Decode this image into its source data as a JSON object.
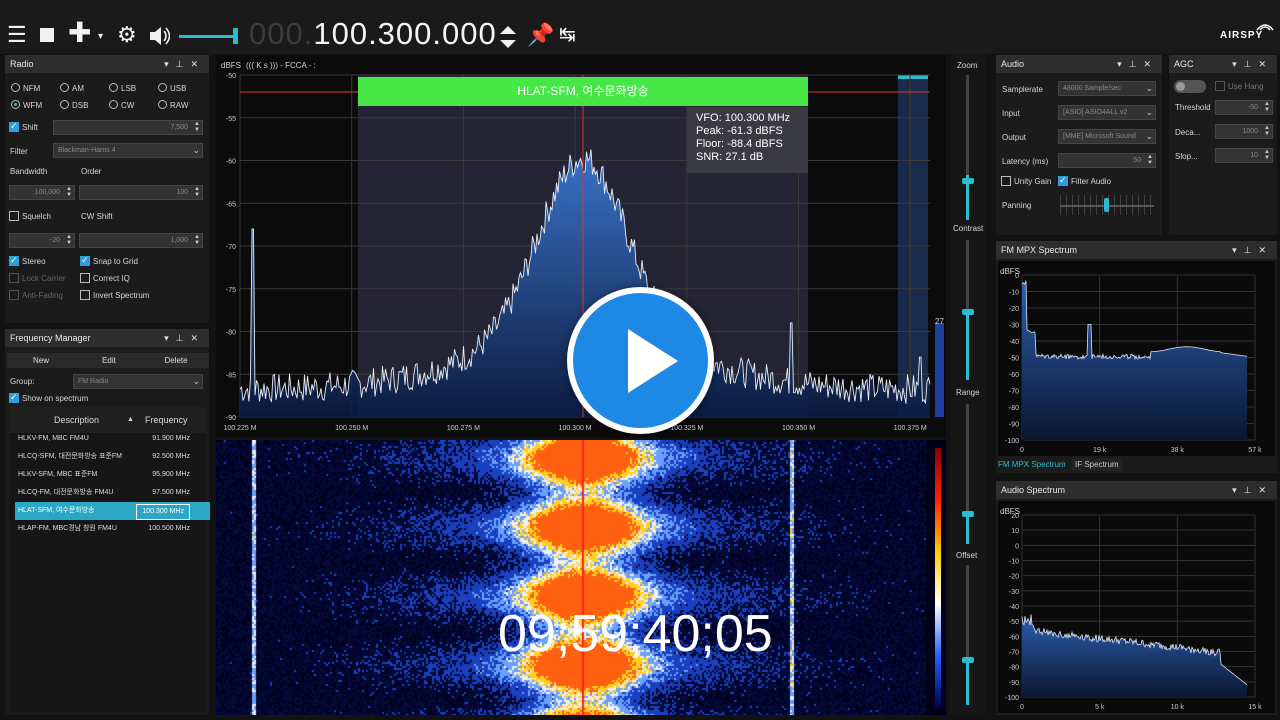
{
  "toolbar": {
    "freq_dim": "000.",
    "freq_main": "100.300.000",
    "brand": "AIRSPY"
  },
  "radio": {
    "title": "Radio",
    "modes": [
      "NFM",
      "AM",
      "LSB",
      "USB",
      "WFM",
      "DSB",
      "CW",
      "RAW"
    ],
    "selected_mode": "WFM",
    "shift_label": "Shift",
    "shift_value": "7,500",
    "filter_label": "Filter",
    "filter_value": "Blackman-Harris 4",
    "bandwidth_label": "Bandwidth",
    "order_label": "Order",
    "bandwidth_value": "100,000",
    "order_value": "100",
    "squelch_label": "Squelch",
    "cw_shift_label": "CW Shift",
    "squelch_value": "-20",
    "cw_shift_value": "1,000",
    "stereo_label": "Stereo",
    "snap_label": "Snap to Grid",
    "lock_label": "Lock Carrier",
    "correct_label": "Correct IQ",
    "anti_label": "Anti-Fading",
    "invert_label": "Invert Spectrum"
  },
  "freqmgr": {
    "title": "Frequency Manager",
    "new": "New",
    "edit": "Edit",
    "delete": "Delete",
    "group_label": "Group:",
    "group_value": "FM Radio",
    "show_label": "Show on spectrum",
    "col_desc": "Description",
    "col_freq": "Frequency",
    "rows": [
      {
        "d": "HLKV-FM, MBC FM4U",
        "f": "91.900 MHz"
      },
      {
        "d": "HLCQ-SFM, 대전문화방송 표준FM",
        "f": "92.500 MHz"
      },
      {
        "d": "HLKV-SFM,  MBC 표준FM",
        "f": "95.900 MHz"
      },
      {
        "d": "HLCQ-FM, 대전문화방송 FM4U",
        "f": "97.500 MHz"
      },
      {
        "d": "HLAT-SFM, 여수문화방송",
        "f": "100.300 MHz"
      },
      {
        "d": "HLAP-FM,  MBC경남 창원 FM4U",
        "f": "100.500 MHz"
      }
    ]
  },
  "main": {
    "dbfs": "dBFS",
    "rds": "(((      K  s      )))  -  FCCA  -                                        :",
    "band_label": "HLAT-SFM, 여수문화방송",
    "info": [
      "VFO:  100.300 MHz",
      "Peak: -61.3 dBFS",
      "Floor: -88.4 dBFS",
      "SNR:  27.1 dB"
    ],
    "yticks": [
      "-50",
      "-55",
      "-60",
      "-65",
      "-70",
      "-75",
      "-80",
      "-85",
      "-90"
    ],
    "xticks": [
      "100.225 M",
      "100.250 M",
      "100.275 M",
      "100.300 M",
      "100.325 M",
      "100.350 M",
      "100.375 M"
    ],
    "side_value": "27",
    "timecode": "09;59;40;05"
  },
  "sliders": {
    "zoom": "Zoom",
    "contrast": "Contrast",
    "range": "Range",
    "offset": "Offset"
  },
  "audio": {
    "title": "Audio",
    "samplerate_label": "Samplerate",
    "samplerate_value": "48000 Sample/sec",
    "input_label": "Input",
    "input_value": "[ASIO] ASIO4ALL v2",
    "output_label": "Output",
    "output_value": "[MME] Microsoft Sound",
    "latency_label": "Latency (ms)",
    "latency_value": "50",
    "unity_label": "Unity Gain",
    "filter_label": "Filter Audio",
    "panning_label": "Panning"
  },
  "agc": {
    "title": "AGC",
    "use_hang": "Use Hang",
    "threshold_label": "Threshold",
    "threshold_value": "-50",
    "decay_label": "Deca...",
    "decay_value": "1000",
    "slope_label": "Slop...",
    "slope_value": "10"
  },
  "mpx": {
    "title": "FM MPX Spectrum",
    "dbfs": "dBFS",
    "yticks": [
      "0",
      "-10",
      "-20",
      "-30",
      "-40",
      "-50",
      "-60",
      "-70",
      "-80",
      "-90",
      "-100"
    ],
    "xticks": [
      "0",
      "19 k",
      "38 k",
      "57 k"
    ],
    "tab1": "FM MPX Spectrum",
    "tab2": "IF Spectrum"
  },
  "aspec": {
    "title": "Audio Spectrum",
    "dbfs": "dBFS",
    "yticks": [
      "20",
      "10",
      "0",
      "-10",
      "-20",
      "-30",
      "-40",
      "-50",
      "-60",
      "-70",
      "-80",
      "-90",
      "-100"
    ],
    "xticks": [
      "0",
      "5 k",
      "10 k",
      "15 k"
    ]
  },
  "colors": {
    "accent": "#2e9ed6",
    "band": "#46e646",
    "cursor": "#e03030"
  }
}
